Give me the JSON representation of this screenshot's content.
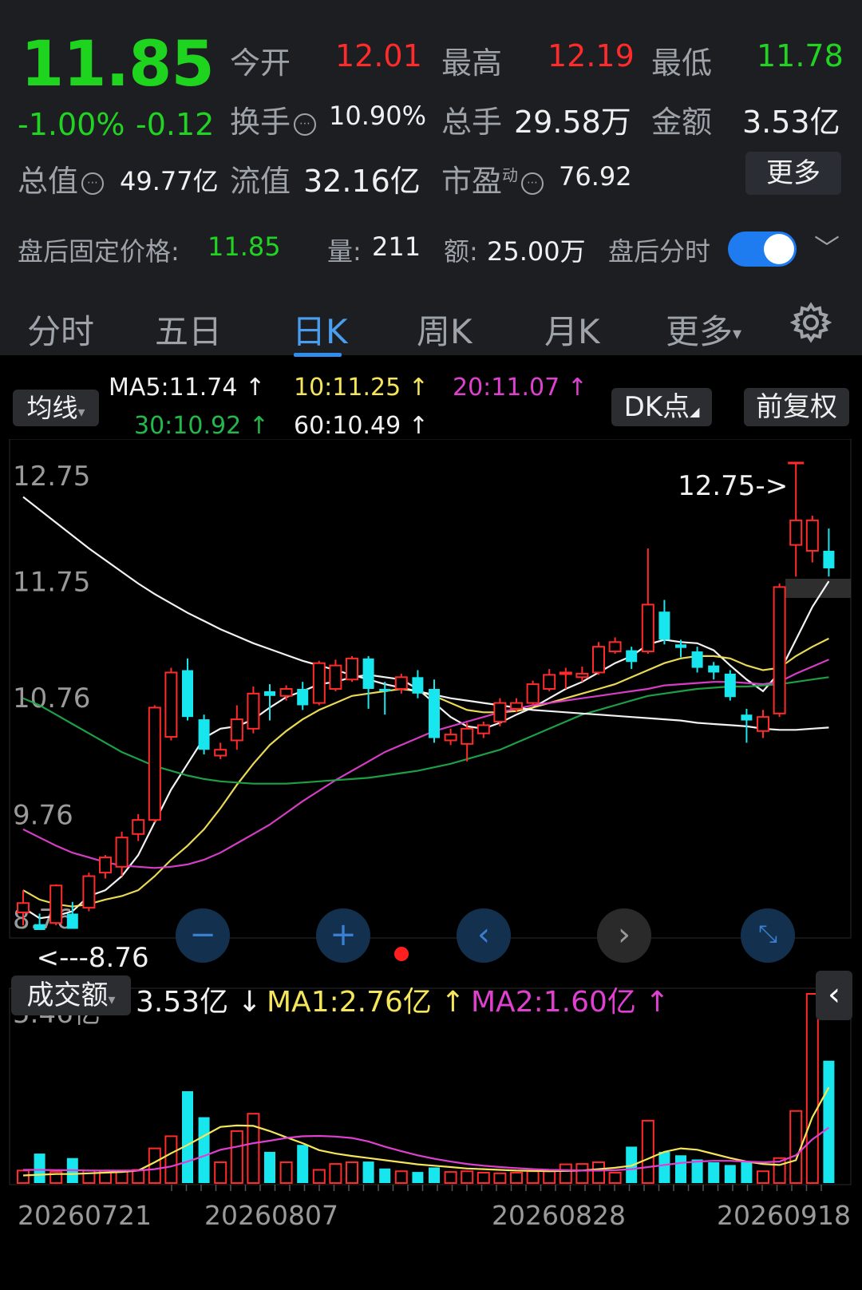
{
  "quote": {
    "price": "11.85",
    "change_pct": "-1.00%",
    "change_amt": "-0.12",
    "open_label": "今开",
    "open_value": "12.01",
    "high_label": "最高",
    "high_value": "12.19",
    "low_label": "最低",
    "low_value": "11.78",
    "turnover_label": "换手",
    "turnover_value": "10.90%",
    "volume_label": "总手",
    "volume_value": "29.58万",
    "amount_label": "金额",
    "amount_value": "3.53亿",
    "mcap_label": "总值",
    "mcap_value": "49.77亿",
    "float_label": "流值",
    "float_value": "32.16亿",
    "pe_label": "市盈",
    "pe_sup": "动",
    "pe_value": "76.92",
    "more_label": "更多",
    "info_icon": "info-circle-icon"
  },
  "after_hours": {
    "price_label": "盘后固定价格:",
    "price_value": "11.85",
    "vol_label": "量:",
    "vol_value": "211",
    "amt_label": "额:",
    "amt_value": "25.00万",
    "toggle_label": "盘后分时",
    "toggle_on": true
  },
  "tabs": [
    {
      "label": "分时"
    },
    {
      "label": "五日"
    },
    {
      "label": "日K"
    },
    {
      "label": "周K"
    },
    {
      "label": "月K"
    },
    {
      "label": "更多"
    }
  ],
  "active_tab": "日K",
  "kline": {
    "ma_selector": "均线",
    "ma5": "MA5:11.74",
    "ma10": "10:11.25",
    "ma20": "20:11.07",
    "ma30": "30:10.92",
    "ma60": "60:10.49",
    "dk_label": "DK点",
    "adjust_label": "前复权",
    "max_marker": "12.75->",
    "min_marker": "<---8.76"
  },
  "volume_panel": {
    "selector": "成交额",
    "current": "3.53亿",
    "ma1": "MA1:2.76亿",
    "ma2": "MA2:1.60亿",
    "max_label": "5.46亿"
  },
  "colors": {
    "up": "#ff2b2b",
    "down": "#18e6ee",
    "ma5": "#ffffff",
    "ma10": "#f5e55a",
    "ma20": "#e040d0",
    "ma30": "#1fa84a",
    "ma60": "#ffffff",
    "accent": "#2f8df0"
  },
  "chart_data": {
    "type": "candlestick",
    "title": "",
    "x_ticks": [
      "20260721",
      "20260807",
      "20260828",
      "20260918"
    ],
    "y_ticks": [
      "12.75",
      "11.75",
      "10.76",
      "9.76",
      "8.76"
    ],
    "ylim": [
      8.76,
      12.75
    ],
    "candles": [
      {
        "o": 8.91,
        "c": 8.99,
        "h": 9.1,
        "l": 8.8
      },
      {
        "o": 8.81,
        "c": 8.76,
        "h": 8.9,
        "l": 8.76
      },
      {
        "o": 8.82,
        "c": 9.14,
        "h": 9.15,
        "l": 8.8
      },
      {
        "o": 8.9,
        "c": 8.77,
        "h": 9.0,
        "l": 8.77
      },
      {
        "o": 8.95,
        "c": 9.22,
        "h": 9.25,
        "l": 8.92
      },
      {
        "o": 9.25,
        "c": 9.38,
        "h": 9.4,
        "l": 9.2
      },
      {
        "o": 9.3,
        "c": 9.55,
        "h": 9.6,
        "l": 9.22
      },
      {
        "o": 9.58,
        "c": 9.7,
        "h": 9.75,
        "l": 9.52
      },
      {
        "o": 9.7,
        "c": 10.66,
        "h": 10.68,
        "l": 9.68
      },
      {
        "o": 10.41,
        "c": 10.96,
        "h": 11.0,
        "l": 10.38
      },
      {
        "o": 10.98,
        "c": 10.58,
        "h": 11.08,
        "l": 10.55
      },
      {
        "o": 10.56,
        "c": 10.3,
        "h": 10.6,
        "l": 10.26
      },
      {
        "o": 10.25,
        "c": 10.3,
        "h": 10.36,
        "l": 10.22
      },
      {
        "o": 10.38,
        "c": 10.56,
        "h": 10.68,
        "l": 10.3
      },
      {
        "o": 10.48,
        "c": 10.78,
        "h": 10.84,
        "l": 10.44
      },
      {
        "o": 10.8,
        "c": 10.76,
        "h": 10.86,
        "l": 10.55
      },
      {
        "o": 10.76,
        "c": 10.82,
        "h": 10.85,
        "l": 10.72
      },
      {
        "o": 10.82,
        "c": 10.68,
        "h": 10.88,
        "l": 10.64
      },
      {
        "o": 10.7,
        "c": 11.04,
        "h": 11.06,
        "l": 10.68
      },
      {
        "o": 10.82,
        "c": 11.02,
        "h": 11.07,
        "l": 10.8
      },
      {
        "o": 10.9,
        "c": 11.08,
        "h": 11.1,
        "l": 10.88
      },
      {
        "o": 11.08,
        "c": 10.82,
        "h": 11.1,
        "l": 10.65
      },
      {
        "o": 10.82,
        "c": 10.8,
        "h": 10.88,
        "l": 10.6
      },
      {
        "o": 10.82,
        "c": 10.92,
        "h": 10.95,
        "l": 10.78
      },
      {
        "o": 10.92,
        "c": 10.78,
        "h": 10.98,
        "l": 10.74
      },
      {
        "o": 10.82,
        "c": 10.4,
        "h": 10.9,
        "l": 10.36
      },
      {
        "o": 10.38,
        "c": 10.43,
        "h": 10.48,
        "l": 10.34
      },
      {
        "o": 10.35,
        "c": 10.48,
        "h": 10.53,
        "l": 10.2
      },
      {
        "o": 10.44,
        "c": 10.51,
        "h": 10.54,
        "l": 10.4
      },
      {
        "o": 10.54,
        "c": 10.7,
        "h": 10.74,
        "l": 10.5
      },
      {
        "o": 10.65,
        "c": 10.7,
        "h": 10.74,
        "l": 10.62
      },
      {
        "o": 10.7,
        "c": 10.86,
        "h": 10.89,
        "l": 10.68
      },
      {
        "o": 10.82,
        "c": 10.94,
        "h": 10.99,
        "l": 10.8
      },
      {
        "o": 10.96,
        "c": 10.96,
        "h": 11.0,
        "l": 10.82
      },
      {
        "o": 10.92,
        "c": 10.95,
        "h": 11.01,
        "l": 10.88
      },
      {
        "o": 10.96,
        "c": 11.18,
        "h": 11.22,
        "l": 10.94
      },
      {
        "o": 11.14,
        "c": 11.22,
        "h": 11.26,
        "l": 11.12
      },
      {
        "o": 11.15,
        "c": 11.05,
        "h": 11.18,
        "l": 10.99
      },
      {
        "o": 11.14,
        "c": 11.54,
        "h": 12.02,
        "l": 11.12
      },
      {
        "o": 11.48,
        "c": 11.24,
        "h": 11.58,
        "l": 11.2
      },
      {
        "o": 11.2,
        "c": 11.17,
        "h": 11.24,
        "l": 11.09
      },
      {
        "o": 11.14,
        "c": 11.0,
        "h": 11.18,
        "l": 10.96
      },
      {
        "o": 11.02,
        "c": 10.96,
        "h": 11.05,
        "l": 10.9
      },
      {
        "o": 10.95,
        "c": 10.75,
        "h": 10.98,
        "l": 10.72
      },
      {
        "o": 10.6,
        "c": 10.55,
        "h": 10.65,
        "l": 10.36
      },
      {
        "o": 10.46,
        "c": 10.58,
        "h": 10.64,
        "l": 10.4
      },
      {
        "o": 10.61,
        "c": 11.69,
        "h": 11.72,
        "l": 10.58
      },
      {
        "o": 12.05,
        "c": 12.26,
        "h": 12.75,
        "l": 11.78
      },
      {
        "o": 12.0,
        "c": 12.26,
        "h": 12.3,
        "l": 11.9
      },
      {
        "o": 12.0,
        "c": 11.85,
        "h": 12.19,
        "l": 11.78
      }
    ],
    "ma": [
      {
        "name": "MA5",
        "values": [
          8.95,
          8.86,
          8.88,
          8.92,
          9.05,
          9.1,
          9.22,
          9.4,
          9.68,
          9.96,
          10.18,
          10.4,
          10.48,
          10.5,
          10.56,
          10.66,
          10.75,
          10.8,
          10.86,
          10.88,
          10.92,
          10.94,
          10.92,
          10.9,
          10.82,
          10.7,
          10.58,
          10.5,
          10.48,
          10.53,
          10.6,
          10.66,
          10.74,
          10.82,
          10.88,
          10.96,
          11.04,
          11.1,
          11.2,
          11.24,
          11.22,
          11.21,
          11.15,
          11.02,
          10.9,
          10.8,
          10.96,
          11.24,
          11.52,
          11.74
        ]
      },
      {
        "name": "MA10",
        "values": [
          9.1,
          9.02,
          8.98,
          8.96,
          8.98,
          9.02,
          9.05,
          9.1,
          9.22,
          9.36,
          9.48,
          9.62,
          9.8,
          10.0,
          10.18,
          10.34,
          10.46,
          10.56,
          10.64,
          10.7,
          10.76,
          10.78,
          10.8,
          10.82,
          10.8,
          10.76,
          10.7,
          10.64,
          10.62,
          10.62,
          10.63,
          10.66,
          10.7,
          10.74,
          10.78,
          10.82,
          10.86,
          10.92,
          10.98,
          11.04,
          11.08,
          11.1,
          11.1,
          11.08,
          11.02,
          10.98,
          11.0,
          11.1,
          11.18,
          11.25
        ]
      },
      {
        "name": "MA20",
        "values": [
          9.62,
          9.55,
          9.48,
          9.42,
          9.38,
          9.34,
          9.31,
          9.3,
          9.29,
          9.3,
          9.32,
          9.36,
          9.42,
          9.5,
          9.58,
          9.66,
          9.76,
          9.86,
          9.95,
          10.04,
          10.12,
          10.2,
          10.28,
          10.34,
          10.4,
          10.46,
          10.5,
          10.54,
          10.58,
          10.62,
          10.65,
          10.68,
          10.7,
          10.72,
          10.74,
          10.76,
          10.78,
          10.8,
          10.82,
          10.85,
          10.86,
          10.87,
          10.88,
          10.88,
          10.87,
          10.86,
          10.88,
          10.95,
          11.01,
          11.07
        ]
      },
      {
        "name": "MA30",
        "values": [
          10.74,
          10.68,
          10.6,
          10.52,
          10.44,
          10.36,
          10.28,
          10.22,
          10.16,
          10.12,
          10.08,
          10.05,
          10.03,
          10.02,
          10.01,
          10.01,
          10.01,
          10.02,
          10.03,
          10.04,
          10.05,
          10.06,
          10.08,
          10.1,
          10.12,
          10.15,
          10.18,
          10.22,
          10.26,
          10.3,
          10.36,
          10.42,
          10.48,
          10.54,
          10.6,
          10.64,
          10.68,
          10.72,
          10.76,
          10.78,
          10.8,
          10.82,
          10.83,
          10.84,
          10.84,
          10.85,
          10.86,
          10.88,
          10.9,
          10.92
        ]
      },
      {
        "name": "MA60",
        "values": [
          12.46,
          12.35,
          12.24,
          12.13,
          12.02,
          11.92,
          11.82,
          11.72,
          11.63,
          11.55,
          11.47,
          11.4,
          11.33,
          11.27,
          11.21,
          11.16,
          11.11,
          11.06,
          11.02,
          10.98,
          10.94,
          10.9,
          10.86,
          10.83,
          10.8,
          10.77,
          10.74,
          10.72,
          10.7,
          10.68,
          10.66,
          10.64,
          10.63,
          10.62,
          10.61,
          10.6,
          10.59,
          10.58,
          10.57,
          10.56,
          10.55,
          10.53,
          10.52,
          10.51,
          10.5,
          10.48,
          10.47,
          10.47,
          10.48,
          10.49
        ]
      }
    ],
    "volume_ylim": [
      0,
      5.46
    ],
    "volume": [
      0.36,
      0.85,
      0.32,
      0.72,
      0.36,
      0.35,
      0.34,
      0.38,
      1.0,
      1.35,
      2.65,
      1.9,
      0.6,
      1.5,
      2.0,
      0.9,
      0.6,
      1.1,
      0.38,
      0.55,
      0.6,
      0.62,
      0.42,
      0.34,
      0.32,
      0.45,
      0.32,
      0.34,
      0.3,
      0.28,
      0.3,
      0.34,
      0.34,
      0.54,
      0.55,
      0.6,
      0.3,
      1.05,
      1.8,
      0.9,
      0.8,
      0.68,
      0.6,
      0.52,
      0.6,
      0.34,
      0.72,
      2.08,
      5.46,
      3.53
    ],
    "volume_ma": [
      {
        "name": "MA1",
        "values": [
          0.22,
          0.24,
          0.26,
          0.26,
          0.28,
          0.3,
          0.32,
          0.36,
          0.6,
          0.86,
          1.1,
          1.36,
          1.62,
          1.66,
          1.65,
          1.5,
          1.32,
          1.15,
          0.95,
          0.85,
          0.78,
          0.72,
          0.66,
          0.6,
          0.54,
          0.5,
          0.46,
          0.42,
          0.4,
          0.38,
          0.36,
          0.35,
          0.34,
          0.35,
          0.36,
          0.4,
          0.44,
          0.5,
          0.7,
          0.9,
          1.0,
          0.96,
          0.84,
          0.72,
          0.62,
          0.55,
          0.52,
          0.66,
          1.9,
          2.76
        ]
      },
      {
        "name": "MA2",
        "values": [
          0.38,
          0.38,
          0.37,
          0.37,
          0.36,
          0.36,
          0.36,
          0.36,
          0.4,
          0.48,
          0.62,
          0.78,
          0.96,
          1.05,
          1.15,
          1.22,
          1.3,
          1.35,
          1.36,
          1.34,
          1.3,
          1.2,
          1.05,
          0.92,
          0.8,
          0.7,
          0.62,
          0.55,
          0.5,
          0.46,
          0.43,
          0.4,
          0.38,
          0.37,
          0.36,
          0.36,
          0.37,
          0.4,
          0.46,
          0.52,
          0.58,
          0.62,
          0.64,
          0.64,
          0.62,
          0.6,
          0.62,
          0.8,
          1.26,
          1.6
        ]
      }
    ]
  }
}
